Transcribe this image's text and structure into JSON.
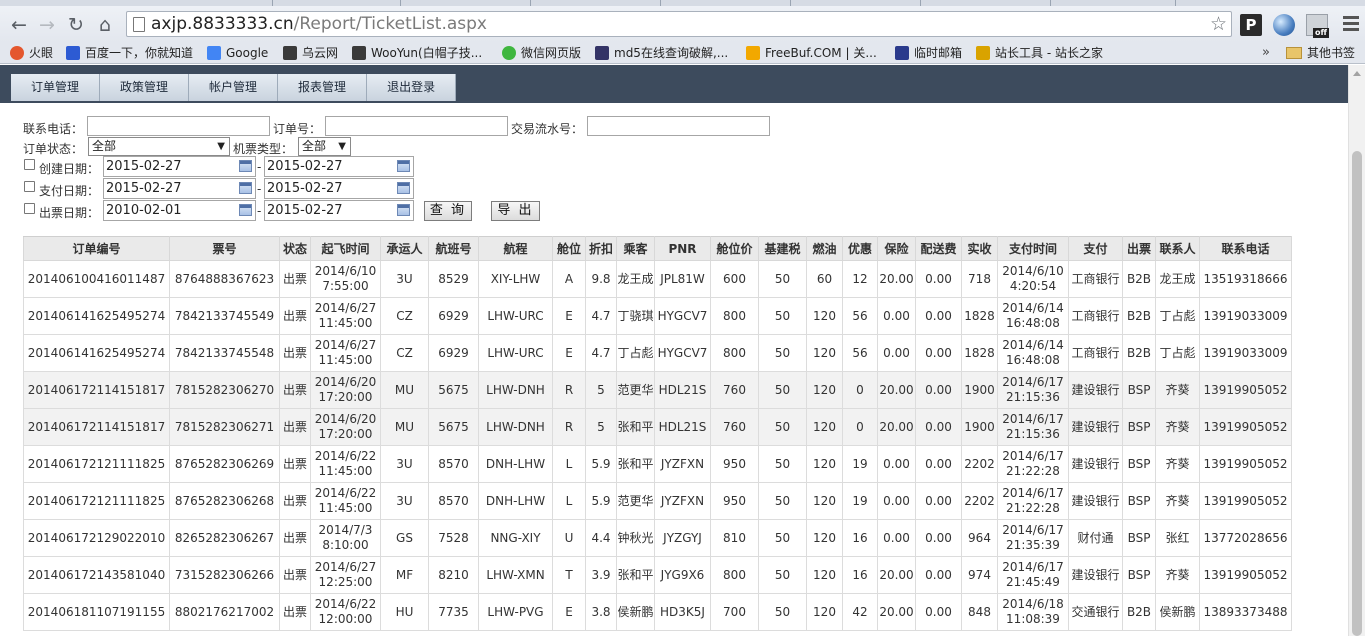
{
  "browser": {
    "url_host": "axjp.8833333.cn",
    "url_path": "/Report/TicketList.aspx",
    "bookmarks": [
      {
        "label": "火眼",
        "color": "#e4572e"
      },
      {
        "label": "百度一下，你就知道",
        "color": "#2d5bd3"
      },
      {
        "label": "Google",
        "color": "#4285f4"
      },
      {
        "label": "乌云网",
        "color": "#3a3a3a"
      },
      {
        "label": "WooYun(白帽子技...",
        "color": "#3a3a3a"
      },
      {
        "label": "微信网页版",
        "color": "#3fb63f"
      },
      {
        "label": "md5在线查询破解,...",
        "color": "#333366"
      },
      {
        "label": "FreeBuf.COM | 关...",
        "color": "#f2a800"
      },
      {
        "label": "临时邮箱",
        "color": "#2a3a8c"
      },
      {
        "label": "站长工具 - 站长之家",
        "color": "#d9a300"
      }
    ],
    "more": "»",
    "other_bookmarks": "其他书签"
  },
  "nav": {
    "items": [
      "订单管理",
      "政策管理",
      "帐户管理",
      "报表管理",
      "退出登录"
    ]
  },
  "filters": {
    "phone_label": "联系电话：",
    "phone_value": "",
    "order_no_label": "订单号：",
    "order_no_value": "",
    "serial_label": "交易流水号：",
    "serial_value": "",
    "status_label": "订单状态：",
    "status_value": "全部",
    "ticket_type_label": "机票类型：",
    "ticket_type_value": "全部",
    "create_label": "创建日期：",
    "create_from": "2015-02-27",
    "create_to": "2015-02-27",
    "pay_label": "支付日期：",
    "pay_from": "2015-02-27",
    "pay_to": "2015-02-27",
    "issue_label": "出票日期：",
    "issue_from": "2010-02-01",
    "issue_to": "2015-02-27",
    "separator": "-",
    "query_button": "查 询",
    "export_button": "导 出"
  },
  "table": {
    "columns": [
      "订单编号",
      "票号",
      "状态",
      "起飞时间",
      "承运人",
      "航班号",
      "航程",
      "舱位",
      "折扣",
      "乘客",
      "PNR",
      "舱位价",
      "基建税",
      "燃油",
      "优惠",
      "保险",
      "配送费",
      "实收",
      "支付时间",
      "支付",
      "出票",
      "联系人",
      "联系电话"
    ],
    "rows": [
      [
        "201406100416011487",
        "8764888367623",
        "出票",
        "2014/6/10 7:55:00",
        "3U",
        "8529",
        "XIY-LHW",
        "A",
        "9.8",
        "龙王成",
        "JPL81W",
        "600",
        "50",
        "60",
        "12",
        "20.00",
        "0.00",
        "718",
        "2014/6/10 4:20:54",
        "工商银行",
        "B2B",
        "龙王成",
        "13519318666"
      ],
      [
        "201406141625495274",
        "7842133745549",
        "出票",
        "2014/6/27 11:45:00",
        "CZ",
        "6929",
        "LHW-URC",
        "E",
        "4.7",
        "丁骁琪",
        "HYGCV7",
        "800",
        "50",
        "120",
        "56",
        "0.00",
        "0.00",
        "1828",
        "2014/6/14 16:48:08",
        "工商银行",
        "B2B",
        "丁占彪",
        "13919033009"
      ],
      [
        "201406141625495274",
        "7842133745548",
        "出票",
        "2014/6/27 11:45:00",
        "CZ",
        "6929",
        "LHW-URC",
        "E",
        "4.7",
        "丁占彪",
        "HYGCV7",
        "800",
        "50",
        "120",
        "56",
        "0.00",
        "0.00",
        "1828",
        "2014/6/14 16:48:08",
        "工商银行",
        "B2B",
        "丁占彪",
        "13919033009"
      ],
      [
        "201406172114151817",
        "7815282306270",
        "出票",
        "2014/6/20 17:20:00",
        "MU",
        "5675",
        "LHW-DNH",
        "R",
        "5",
        "范更华",
        "HDL21S",
        "760",
        "50",
        "120",
        "0",
        "20.00",
        "0.00",
        "1900",
        "2014/6/17 21:15:36",
        "建设银行",
        "BSP",
        "齐葵",
        "13919905052"
      ],
      [
        "201406172114151817",
        "7815282306271",
        "出票",
        "2014/6/20 17:20:00",
        "MU",
        "5675",
        "LHW-DNH",
        "R",
        "5",
        "张和平",
        "HDL21S",
        "760",
        "50",
        "120",
        "0",
        "20.00",
        "0.00",
        "1900",
        "2014/6/17 21:15:36",
        "建设银行",
        "BSP",
        "齐葵",
        "13919905052"
      ],
      [
        "201406172121111825",
        "8765282306269",
        "出票",
        "2014/6/22 11:45:00",
        "3U",
        "8570",
        "DNH-LHW",
        "L",
        "5.9",
        "张和平",
        "JYZFXN",
        "950",
        "50",
        "120",
        "19",
        "0.00",
        "0.00",
        "2202",
        "2014/6/17 21:22:28",
        "建设银行",
        "BSP",
        "齐葵",
        "13919905052"
      ],
      [
        "201406172121111825",
        "8765282306268",
        "出票",
        "2014/6/22 11:45:00",
        "3U",
        "8570",
        "DNH-LHW",
        "L",
        "5.9",
        "范更华",
        "JYZFXN",
        "950",
        "50",
        "120",
        "19",
        "0.00",
        "0.00",
        "2202",
        "2014/6/17 21:22:28",
        "建设银行",
        "BSP",
        "齐葵",
        "13919905052"
      ],
      [
        "201406172129022010",
        "8265282306267",
        "出票",
        "2014/7/3 8:10:00",
        "GS",
        "7528",
        "NNG-XIY",
        "U",
        "4.4",
        "钟秋光",
        "JYZGYJ",
        "810",
        "50",
        "120",
        "16",
        "0.00",
        "0.00",
        "964",
        "2014/6/17 21:35:39",
        "财付通",
        "BSP",
        "张红",
        "13772028656"
      ],
      [
        "201406172143581040",
        "7315282306266",
        "出票",
        "2014/6/27 12:25:00",
        "MF",
        "8210",
        "LHW-XMN",
        "T",
        "3.9",
        "张和平",
        "JYG9X6",
        "800",
        "50",
        "120",
        "16",
        "20.00",
        "0.00",
        "974",
        "2014/6/17 21:45:49",
        "建设银行",
        "BSP",
        "齐葵",
        "13919905052"
      ],
      [
        "201406181107191155",
        "8802176217002",
        "出票",
        "2014/6/22 12:00:00",
        "HU",
        "7735",
        "LHW-PVG",
        "E",
        "3.8",
        "侯新鹏",
        "HD3K5J",
        "700",
        "50",
        "120",
        "42",
        "20.00",
        "0.00",
        "848",
        "2014/6/18 11:08:39",
        "交通银行",
        "B2B",
        "侯新鹏",
        "13893373488"
      ]
    ]
  }
}
